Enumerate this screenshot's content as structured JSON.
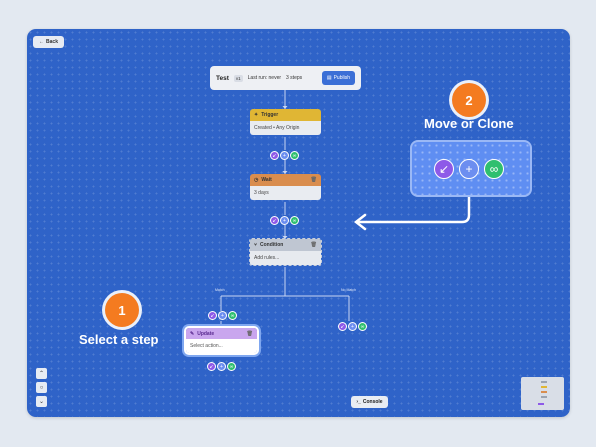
{
  "toolbar": {
    "back_label": "Back"
  },
  "workflow": {
    "title": "Test",
    "version": "v1",
    "last_run": "Last run: never",
    "steps": "3 steps",
    "publish_label": "Publish"
  },
  "nodes": {
    "trigger": {
      "title": "Trigger",
      "body": "Created • Any Origin"
    },
    "wait": {
      "title": "Wait",
      "body": "3 days"
    },
    "condition": {
      "title": "Condition",
      "body": "Add rules..."
    },
    "update": {
      "title": "Update",
      "body": "Select action..."
    }
  },
  "branches": {
    "left": "Match",
    "right": "No Match"
  },
  "callouts": [
    {
      "number": "1",
      "label": "Select a step"
    },
    {
      "number": "2",
      "label": "Move or Clone"
    }
  ],
  "footer": {
    "console_label": "Console"
  },
  "icons": {
    "back": "arrow-left-icon",
    "publish": "file-icon",
    "trigger": "bolt-icon",
    "wait": "clock-icon",
    "condition": "branch-icon",
    "update": "pencil-icon",
    "move": "arrow-move-icon",
    "add": "plus-icon",
    "clone": "link-icon"
  },
  "colors": {
    "canvas": "#2f63c8",
    "accent_orange": "#f47b20",
    "trigger": "#e0b634",
    "wait": "#d98d4e",
    "update": "#c9a6ee"
  }
}
